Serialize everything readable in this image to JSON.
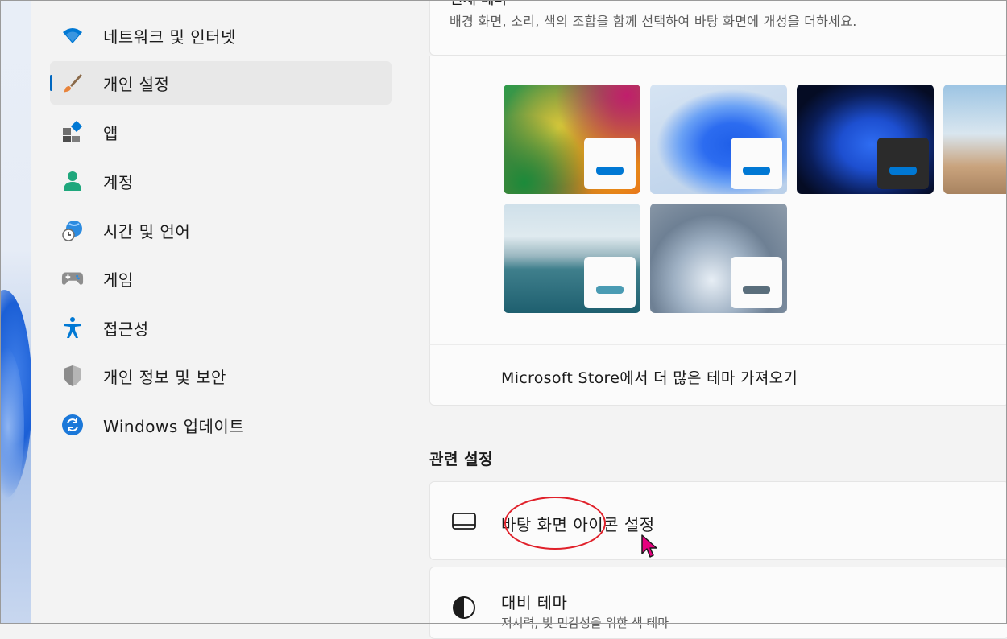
{
  "sidebar": {
    "items": [
      {
        "label": "네트워크 및 인터넷",
        "icon": "wifi-icon"
      },
      {
        "label": "개인 설정",
        "icon": "paintbrush-icon",
        "selected": true
      },
      {
        "label": "앱",
        "icon": "apps-icon"
      },
      {
        "label": "계정",
        "icon": "account-icon"
      },
      {
        "label": "시간 및 언어",
        "icon": "time-language-icon"
      },
      {
        "label": "게임",
        "icon": "gamepad-icon"
      },
      {
        "label": "접근성",
        "icon": "accessibility-icon"
      },
      {
        "label": "개인 정보 및 보안",
        "icon": "shield-icon"
      },
      {
        "label": "Windows 업데이트",
        "icon": "update-icon"
      }
    ]
  },
  "themes": {
    "title": "현재 테마",
    "description": "배경 화면, 소리, 색의 조합을 함께 선택하여 바탕 화면에 개성을 더하세요.",
    "store_link": "Microsoft Store에서 더 많은 테마 가져오기",
    "tiles": [
      {
        "name": "colorful-theme",
        "accent": "#0078d4"
      },
      {
        "name": "windows-light-theme",
        "accent": "#0078d4"
      },
      {
        "name": "windows-dark-theme",
        "accent": "#0078d4"
      },
      {
        "name": "glow-theme",
        "accent": "#0078d4"
      },
      {
        "name": "captured-motion-theme",
        "accent": "#4a9bb3"
      },
      {
        "name": "sunrise-theme",
        "accent": "#5a6e7c"
      }
    ]
  },
  "related": {
    "header": "관련 설정",
    "desktop_icons": {
      "label": "바탕 화면 아이콘 설정",
      "icon": "monitor-icon"
    },
    "contrast": {
      "label": "대비 테마",
      "sub": "저시력, 빛 민감성을 위한 색 테마",
      "icon": "contrast-icon"
    }
  },
  "colors": {
    "accent": "#0067c0",
    "annotation": "#e0202a",
    "cursor": "#e6007e"
  }
}
